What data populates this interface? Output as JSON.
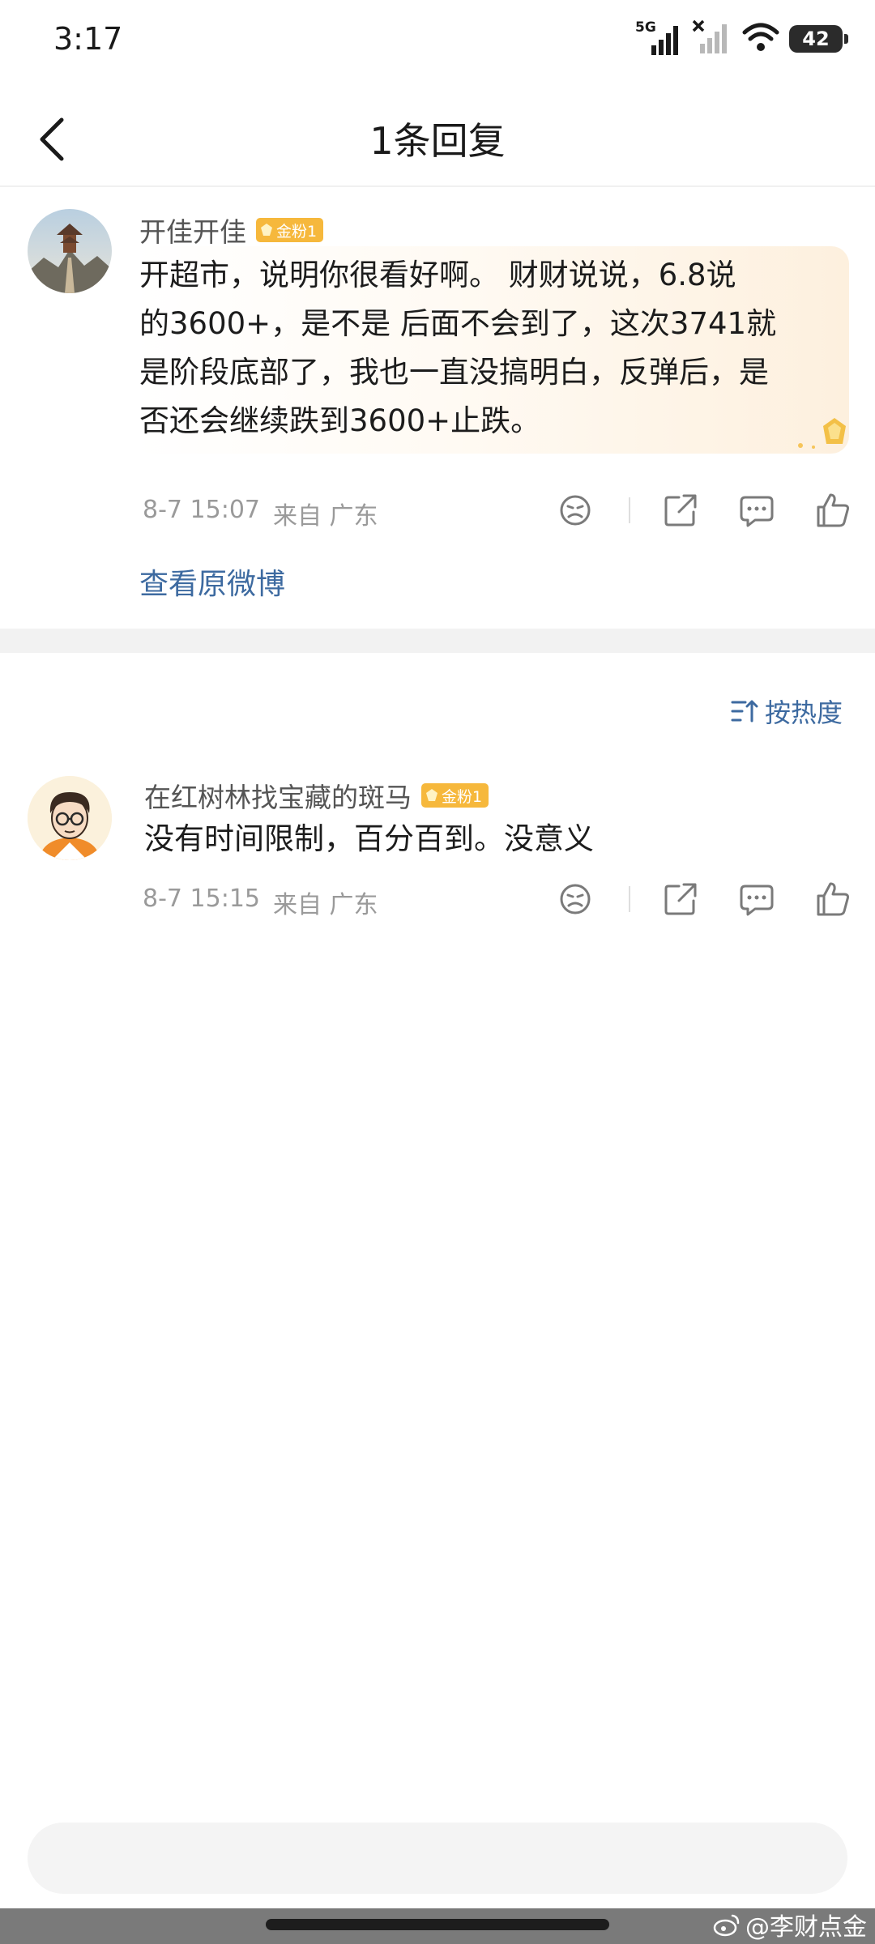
{
  "status_bar": {
    "time": "3:17",
    "network_label": "5G",
    "battery": "42"
  },
  "header": {
    "title": "1条回复"
  },
  "main_post": {
    "username": "开佳开佳",
    "badge": "金粉1",
    "lines": [
      "开超市，说明你很看好啊。 财财说说，6.8说",
      "的3600+，是不是 后面不会到了，这次3741就",
      "是阶段底部了，我也一直没搞明白，反弹后，是",
      "否还会继续跌到3600+止跌。"
    ],
    "timestamp": "8-7 15:07",
    "source": "来自 广东",
    "view_original": "查看原微博"
  },
  "sort": {
    "label": "按热度"
  },
  "reply": {
    "username": "在红树林找宝藏的斑马",
    "badge": "金粉1",
    "text": "没有时间限制，百分百到。没意义",
    "timestamp": "8-7 15:15",
    "source": "来自 广东"
  },
  "watermark": "@李财点金",
  "colors": {
    "link": "#3d6aa0",
    "badge": "#f6b83c",
    "muted": "#9a9a9a"
  },
  "icons": [
    "back-arrow-icon",
    "dislike-face-icon",
    "share-icon",
    "comment-icon",
    "like-icon",
    "sort-icon",
    "weibo-logo-icon"
  ]
}
